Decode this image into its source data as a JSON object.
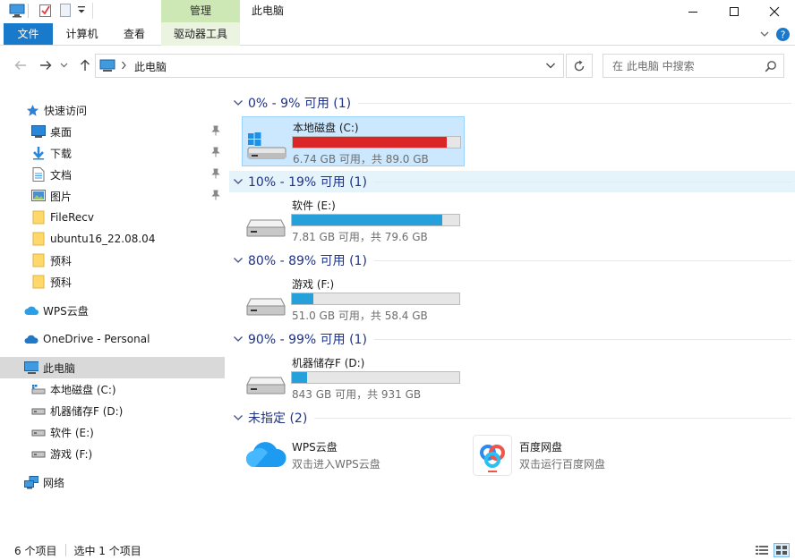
{
  "window": {
    "title": "此电脑",
    "context_tab": "管理"
  },
  "ribbon": {
    "tabs": [
      "文件",
      "计算机",
      "查看",
      "驱动器工具"
    ]
  },
  "address": {
    "path": "此电脑",
    "search_placeholder": "在 此电脑 中搜索"
  },
  "nav": {
    "quick_access": "快速访问",
    "items": [
      {
        "label": "桌面",
        "icon": "desktop-icon",
        "pinned": true
      },
      {
        "label": "下载",
        "icon": "download-icon",
        "pinned": true
      },
      {
        "label": "文档",
        "icon": "document-icon",
        "pinned": true
      },
      {
        "label": "图片",
        "icon": "picture-icon",
        "pinned": true
      },
      {
        "label": "FileRecv",
        "icon": "folder-icon",
        "pinned": false
      },
      {
        "label": "ubuntu16_22.08.04",
        "icon": "folder-icon",
        "pinned": false
      },
      {
        "label": "预科",
        "icon": "folder-icon",
        "pinned": false
      },
      {
        "label": "预科",
        "icon": "folder-icon",
        "pinned": false
      }
    ],
    "wps": "WPS云盘",
    "onedrive": "OneDrive - Personal",
    "this_pc": "此电脑",
    "drives": [
      "本地磁盘 (C:)",
      "机器储存F (D:)",
      "软件 (E:)",
      "游戏 (F:)"
    ],
    "network": "网络"
  },
  "groups": [
    {
      "title": "0% - 9% 可用 (1)"
    },
    {
      "title": "10% - 19% 可用 (1)"
    },
    {
      "title": "80% - 89% 可用 (1)"
    },
    {
      "title": "90% - 99% 可用 (1)"
    },
    {
      "title": "未指定 (2)"
    }
  ],
  "drives": [
    {
      "name": "本地磁盘 (C:)",
      "size": "6.74 GB 可用，共 89.0 GB",
      "used_fraction": 0.92,
      "color": "#da2626"
    },
    {
      "name": "软件 (E:)",
      "size": "7.81 GB 可用，共 79.6 GB",
      "used_fraction": 0.9,
      "color": "#26a0da"
    },
    {
      "name": "游戏 (F:)",
      "size": "51.0 GB 可用，共 58.4 GB",
      "used_fraction": 0.13,
      "color": "#26a0da"
    },
    {
      "name": "机器储存F (D:)",
      "size": "843 GB 可用，共 931 GB",
      "used_fraction": 0.09,
      "color": "#26a0da"
    }
  ],
  "apps": [
    {
      "name": "WPS云盘",
      "desc": "双击进入WPS云盘"
    },
    {
      "name": "百度网盘",
      "desc": "双击运行百度网盘"
    }
  ],
  "status": {
    "count": "6 个项目",
    "selected": "选中 1 个项目"
  }
}
